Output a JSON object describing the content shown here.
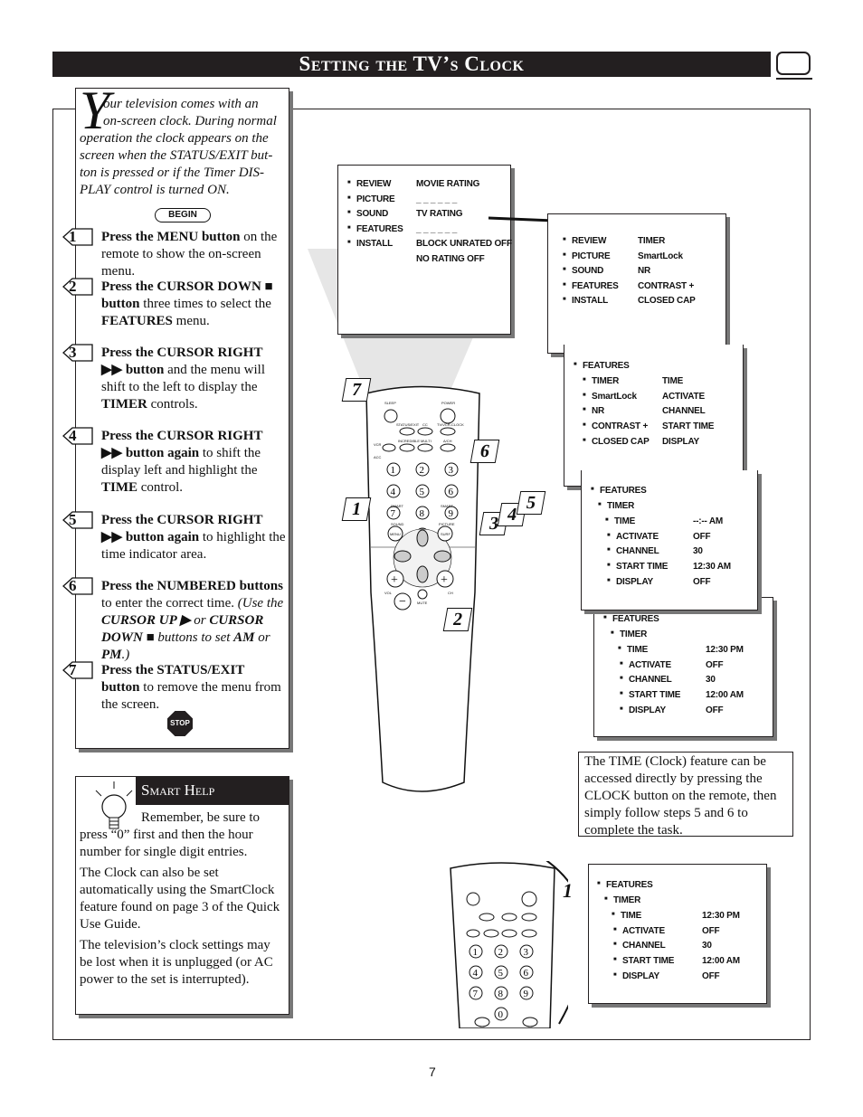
{
  "header": {
    "title": "Setting the TV’s Clock",
    "icon": "tv-screen-icon"
  },
  "intro": {
    "drop_cap": "Y",
    "lines": [
      "our television comes with an",
      "on-screen clock. During normal",
      "operation the clock appears on the",
      "screen when the STATUS/EXIT but-",
      "ton is pressed or if the Timer DIS-",
      "PLAY control is turned ON."
    ],
    "begin_label": "BEGIN"
  },
  "steps": [
    {
      "num": "1",
      "parts": [
        {
          "b": true,
          "t": "Press the MENU button"
        },
        {
          "b": false,
          "t": " on the remote to show the on-screen menu."
        }
      ]
    },
    {
      "num": "2",
      "parts": [
        {
          "b": true,
          "t": "Press the CURSOR DOWN ■ button"
        },
        {
          "b": false,
          "t": " three times to select the "
        },
        {
          "b": true,
          "t": "FEATURES"
        },
        {
          "b": false,
          "t": " menu."
        }
      ]
    },
    {
      "num": "3",
      "parts": [
        {
          "b": true,
          "t": "Press the CURSOR RIGHT ▶▶ button"
        },
        {
          "b": false,
          "t": " and the menu will shift to the left to display the "
        },
        {
          "b": true,
          "t": "TIMER"
        },
        {
          "b": false,
          "t": " controls."
        }
      ]
    },
    {
      "num": "4",
      "parts": [
        {
          "b": true,
          "t": "Press the CURSOR RIGHT ▶▶ button again"
        },
        {
          "b": false,
          "t": " to shift the display left and highlight the "
        },
        {
          "b": true,
          "t": "TIME"
        },
        {
          "b": false,
          "t": " control."
        }
      ]
    },
    {
      "num": "5",
      "parts": [
        {
          "b": true,
          "t": "Press the CURSOR RIGHT ▶▶ button again"
        },
        {
          "b": false,
          "t": " to highlight the time indicator area."
        }
      ]
    },
    {
      "num": "6",
      "parts": [
        {
          "b": true,
          "t": "Press the NUMBERED buttons"
        },
        {
          "b": false,
          "t": " to enter the correct time. "
        },
        {
          "b": false,
          "i": true,
          "t": "(Use the "
        },
        {
          "b": true,
          "i": true,
          "t": "CURSOR UP ▶"
        },
        {
          "b": false,
          "i": true,
          "t": " or "
        },
        {
          "b": true,
          "i": true,
          "t": "CURSOR DOWN ■"
        },
        {
          "b": false,
          "i": true,
          "t": " buttons to set "
        },
        {
          "b": true,
          "i": true,
          "t": "AM"
        },
        {
          "b": false,
          "i": true,
          "t": " or "
        },
        {
          "b": true,
          "i": true,
          "t": "PM"
        },
        {
          "b": false,
          "i": true,
          "t": ".)"
        }
      ]
    },
    {
      "num": "7",
      "parts": [
        {
          "b": true,
          "t": "Press the STATUS/EXIT button"
        },
        {
          "b": false,
          "t": " to remove the menu from the screen."
        }
      ]
    }
  ],
  "stop_label": "STOP",
  "smart_help": {
    "title": "Smart Help",
    "paragraphs": [
      "Remember, be sure to press “0” first and then the hour number for single digit entries.",
      "The Clock can also be set automatically using the SmartClock feature found on page 3 of the Quick Use Guide.",
      "The television’s clock settings may be lost when it is unplugged (or AC power to the set is interrupted)."
    ]
  },
  "menus": {
    "m1": {
      "left": [
        "REVIEW",
        "PICTURE",
        "SOUND",
        "FEATURES",
        "INSTALL"
      ],
      "right": [
        "MOVIE RATING",
        "_ _ _ _ _ _",
        "TV RATING",
        "_ _ _ _ _ _",
        "BLOCK UNRATED OFF",
        "NO RATING        OFF"
      ]
    },
    "m2": {
      "left": [
        "REVIEW",
        "PICTURE",
        "SOUND",
        "FEATURES",
        "INSTALL"
      ],
      "right": [
        "TIMER",
        "SmartLock",
        "NR",
        "CONTRAST +",
        "CLOSED CAP"
      ]
    },
    "m3": {
      "title": "FEATURES",
      "left": [
        "TIMER",
        "SmartLock",
        "NR",
        "CONTRAST +",
        "CLOSED CAP"
      ],
      "right": [
        "TIME",
        "ACTIVATE",
        "CHANNEL",
        "START TIME",
        "DISPLAY"
      ]
    },
    "m4": {
      "title": "FEATURES",
      "sub": "TIMER",
      "left": [
        "TIME",
        "ACTIVATE",
        "CHANNEL",
        "START TIME",
        "DISPLAY"
      ],
      "right": [
        "--:-- AM",
        "OFF",
        "30",
        "12:30 AM",
        "OFF"
      ]
    },
    "m5": {
      "title": "FEATURES",
      "sub": "TIMER",
      "left": [
        "TIME",
        "ACTIVATE",
        "CHANNEL",
        "START TIME",
        "DISPLAY"
      ],
      "right": [
        "12:30 PM",
        "OFF",
        "30",
        "12:00 AM",
        "OFF"
      ]
    },
    "m6": {
      "title": "FEATURES",
      "sub": "TIMER",
      "left": [
        "TIME",
        "ACTIVATE",
        "CHANNEL",
        "START TIME",
        "DISPLAY"
      ],
      "right": [
        "12:30 PM",
        "OFF",
        "30",
        "12:00 AM",
        "OFF"
      ]
    }
  },
  "remote": {
    "labels": [
      "SLEEP",
      "POWER",
      "STATUS/EXIT",
      "CC",
      "TV/VCR-CLOCK",
      "VCR",
      "ACC",
      "INCREDIBLE",
      "MULTI",
      "A/CH",
      "RECORD",
      "STEREO",
      "MEDIA",
      "SMART",
      "SMART",
      "SOUND",
      "PICTURE",
      "MENU",
      "SURF",
      "VOL",
      "CH",
      "MUTE"
    ],
    "digits": [
      "1",
      "2",
      "3",
      "4",
      "5",
      "6",
      "7",
      "8",
      "9",
      "0"
    ],
    "callouts": [
      "7",
      "6",
      "1",
      "3",
      "4",
      "5",
      "2"
    ],
    "callout_bottom": "1"
  },
  "caption": "The TIME (Clock) feature can be accessed directly by pressing the CLOCK button on the remote, then simply follow steps 5 and 6 to complete the task.",
  "page_number": "7"
}
